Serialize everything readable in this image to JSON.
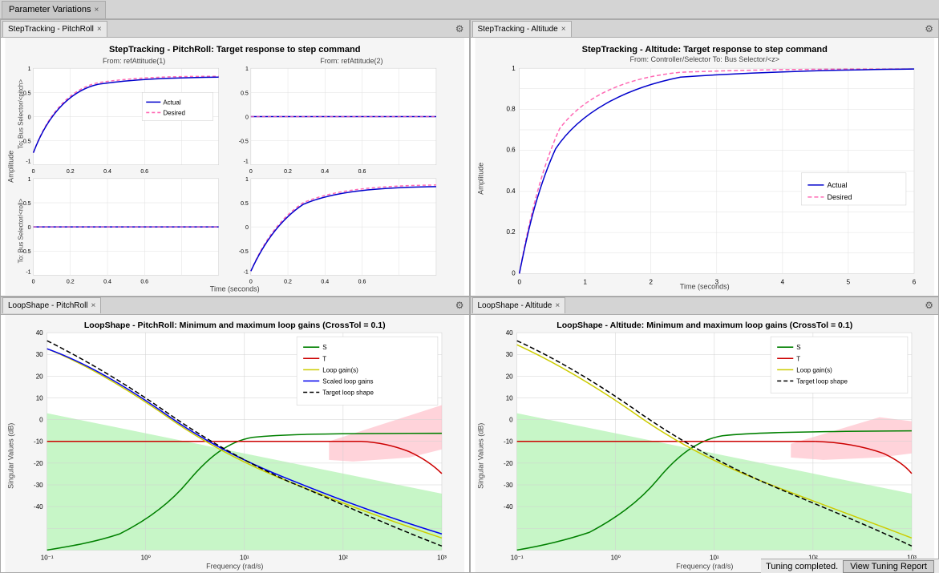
{
  "tabs": {
    "parameter_variations": "Parameter Variations",
    "pitchroll_tab": "StepTracking - PitchRoll",
    "altitude_tab": "StepTracking - Altitude"
  },
  "panels": {
    "top_left": {
      "tab_label": "StepTracking - PitchRoll",
      "title": "StepTracking - PitchRoll: Target response to step command",
      "from1": "From: refAttitude(1)",
      "from2": "From: refAttitude(2)",
      "y_label": "Amplitude",
      "x_label": "Time (seconds)",
      "to1": "To: Bus Selector/<pitch>",
      "to2": "To: Bus Selector/<roll>",
      "legend_actual": "Actual",
      "legend_desired": "Desired"
    },
    "top_right": {
      "tab_label": "StepTracking - Altitude",
      "title": "StepTracking - Altitude: Target response to step command",
      "from": "From: Controller/Selector  To: Bus Selector/<z>",
      "y_label": "Amplitude",
      "x_label": "Time (seconds)",
      "legend_actual": "Actual",
      "legend_desired": "Desired"
    },
    "bottom_left": {
      "tab_label": "LoopShape - PitchRoll",
      "title": "LoopShape - PitchRoll: Minimum and maximum loop gains (CrossTol = 0.1)",
      "y_label": "Singular Values (dB)",
      "x_label": "Frequency (rad/s)",
      "legend": [
        "S",
        "T",
        "Loop gain(s)",
        "Scaled loop gains",
        "Target loop shape"
      ]
    },
    "bottom_right": {
      "tab_label": "LoopShape - Altitude",
      "title": "LoopShape - Altitude: Minimum and maximum loop gains (CrossTol = 0.1)",
      "y_label": "Singular Values (dB)",
      "x_label": "Frequency (rad/s)",
      "legend": [
        "S",
        "T",
        "Loop gain(s)",
        "Target loop shape"
      ]
    }
  },
  "status": {
    "message": "Tuning completed.",
    "button": "View Tuning Report"
  }
}
